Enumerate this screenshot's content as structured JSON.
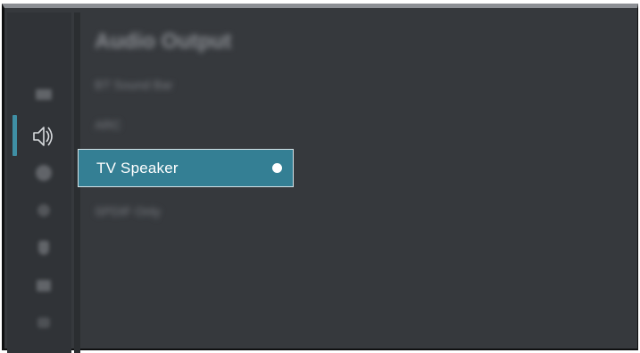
{
  "menu": {
    "title": "Audio Output",
    "options": [
      {
        "label": "BT Sound Bar",
        "selected": false
      },
      {
        "label": "ARC",
        "selected": false
      },
      {
        "label": "TV Speaker",
        "selected": true
      },
      {
        "label": "SPDIF Only",
        "selected": false
      }
    ]
  },
  "sidebar": {
    "icons": [
      "picture-icon",
      "sound-icon",
      "network-icon",
      "display-icon",
      "channel-icon",
      "system-icon",
      "support-icon"
    ],
    "active": "sound-icon"
  },
  "colors": {
    "background": "#36393d",
    "accent": "#347f94",
    "indicator": "#3f8fa4"
  }
}
